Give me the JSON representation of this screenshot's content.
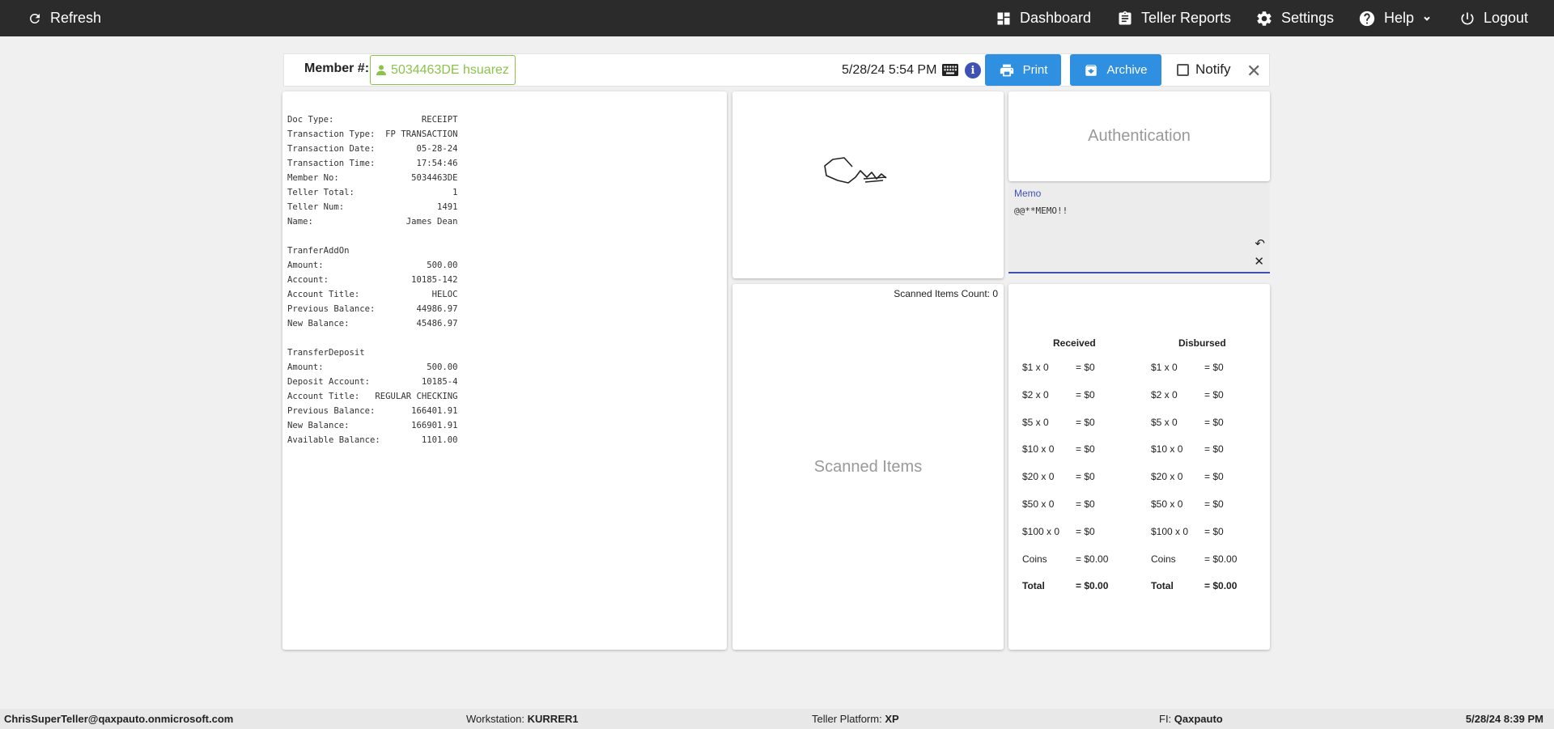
{
  "topbar": {
    "refresh": "Refresh",
    "dashboard": "Dashboard",
    "teller_reports": "Teller Reports",
    "settings": "Settings",
    "help": "Help",
    "logout": "Logout"
  },
  "member": {
    "label": "Member #:",
    "value": "5034463DE hsuarez",
    "datetime": "5/28/24 5:54 PM",
    "print": "Print",
    "archive": "Archive",
    "notify": "Notify",
    "accent": "#8bc34a"
  },
  "receipt": {
    "lines": [
      [
        "Doc Type:",
        "RECEIPT"
      ],
      [
        "Transaction Type:",
        "FP TRANSACTION"
      ],
      [
        "Transaction Date:",
        "05-28-24"
      ],
      [
        "Transaction Time:",
        "17:54:46"
      ],
      [
        "Member No:",
        "5034463DE"
      ],
      [
        "Teller Total:",
        "1"
      ],
      [
        "Teller Num:",
        "1491"
      ],
      [
        "Name:",
        "James Dean"
      ],
      [
        "",
        ""
      ],
      [
        "TranferAddOn",
        ""
      ],
      [
        "Amount:",
        "500.00"
      ],
      [
        "Account:",
        "10185-142"
      ],
      [
        "Account Title:",
        "HELOC"
      ],
      [
        "Previous Balance:",
        "44986.97"
      ],
      [
        "New Balance:",
        "45486.97"
      ],
      [
        "",
        ""
      ],
      [
        "TransferDeposit",
        ""
      ],
      [
        "Amount:",
        "500.00"
      ],
      [
        "Deposit Account:",
        "10185-4"
      ],
      [
        "Account Title:",
        "REGULAR CHECKING"
      ],
      [
        "Previous Balance:",
        "166401.91"
      ],
      [
        "New Balance:",
        "166901.91"
      ],
      [
        "Available Balance:",
        "1101.00"
      ]
    ]
  },
  "authentication": {
    "title": "Authentication"
  },
  "memo": {
    "label": "Memo",
    "value": "@@**MEMO!!"
  },
  "scanned": {
    "count_label": "Scanned Items Count: 0",
    "title": "Scanned Items"
  },
  "cash": {
    "received_header": "Received",
    "disbursed_header": "Disbursed",
    "received": [
      [
        "$1 x 0",
        "= $0"
      ],
      [
        "$2 x 0",
        "= $0"
      ],
      [
        "$5 x 0",
        "= $0"
      ],
      [
        "$10 x 0",
        "= $0"
      ],
      [
        "$20 x 0",
        "= $0"
      ],
      [
        "$50 x 0",
        "= $0"
      ],
      [
        "$100 x 0",
        "= $0"
      ],
      [
        "Coins",
        "= $0.00"
      ],
      [
        "Total",
        "= $0.00"
      ]
    ],
    "disbursed": [
      [
        "$1 x 0",
        "= $0"
      ],
      [
        "$2 x 0",
        "= $0"
      ],
      [
        "$5 x 0",
        "= $0"
      ],
      [
        "$10 x 0",
        "= $0"
      ],
      [
        "$20 x 0",
        "= $0"
      ],
      [
        "$50 x 0",
        "= $0"
      ],
      [
        "$100 x 0",
        "= $0"
      ],
      [
        "Coins",
        "= $0.00"
      ],
      [
        "Total",
        "= $0.00"
      ]
    ]
  },
  "footer": {
    "user": "ChrisSuperTeller@qaxpauto.onmicrosoft.com",
    "workstation_label": "Workstation:",
    "workstation": "KURRER1",
    "platform_label": "Teller Platform:",
    "platform": "XP",
    "fi_label": "FI:",
    "fi": "Qaxpauto",
    "time": "5/28/24 8:39 PM"
  }
}
